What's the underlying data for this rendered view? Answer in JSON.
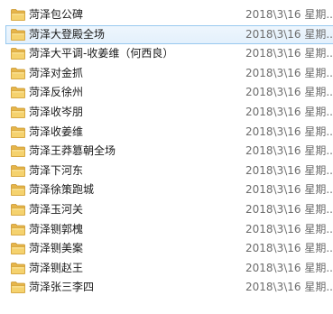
{
  "files": [
    {
      "name": "菏泽包公碑",
      "date": "2018\\3\\16 星期...",
      "icon": "folder-icon",
      "selected": false
    },
    {
      "name": "菏泽大登殿全场",
      "date": "2018\\3\\16 星期...",
      "icon": "folder-icon",
      "selected": true
    },
    {
      "name": "菏泽大平调-收姜维（何西良）",
      "date": "2018\\3\\16 星期...",
      "icon": "folder-icon",
      "selected": false
    },
    {
      "name": "菏泽对金抓",
      "date": "2018\\3\\16 星期...",
      "icon": "folder-icon",
      "selected": false
    },
    {
      "name": "菏泽反徐州",
      "date": "2018\\3\\16 星期...",
      "icon": "folder-icon",
      "selected": false
    },
    {
      "name": "菏泽收岑朋",
      "date": "2018\\3\\16 星期...",
      "icon": "folder-icon",
      "selected": false
    },
    {
      "name": "菏泽收姜维",
      "date": "2018\\3\\16 星期...",
      "icon": "folder-icon",
      "selected": false
    },
    {
      "name": "菏泽王莽篡朝全场",
      "date": "2018\\3\\16 星期...",
      "icon": "folder-icon",
      "selected": false
    },
    {
      "name": "菏泽下河东",
      "date": "2018\\3\\16 星期...",
      "icon": "folder-icon",
      "selected": false
    },
    {
      "name": "菏泽徐策跑城",
      "date": "2018\\3\\16 星期...",
      "icon": "folder-icon",
      "selected": false
    },
    {
      "name": "菏泽玉河关",
      "date": "2018\\3\\16 星期...",
      "icon": "folder-icon",
      "selected": false
    },
    {
      "name": "菏泽铡郭槐",
      "date": "2018\\3\\16 星期...",
      "icon": "folder-icon",
      "selected": false
    },
    {
      "name": "菏泽铡美案",
      "date": "2018\\3\\16 星期...",
      "icon": "folder-icon",
      "selected": false
    },
    {
      "name": "菏泽铡赵王",
      "date": "2018\\3\\16 星期...",
      "icon": "folder-icon",
      "selected": false
    },
    {
      "name": "菏泽张三李四",
      "date": "2018\\3\\16 星期...",
      "icon": "folder-icon",
      "selected": false
    }
  ],
  "colors": {
    "folder_body": "#f5d26e",
    "folder_back": "#e6b54a",
    "selection_border": "#99c9ef",
    "date_text": "#6d6d6d"
  }
}
